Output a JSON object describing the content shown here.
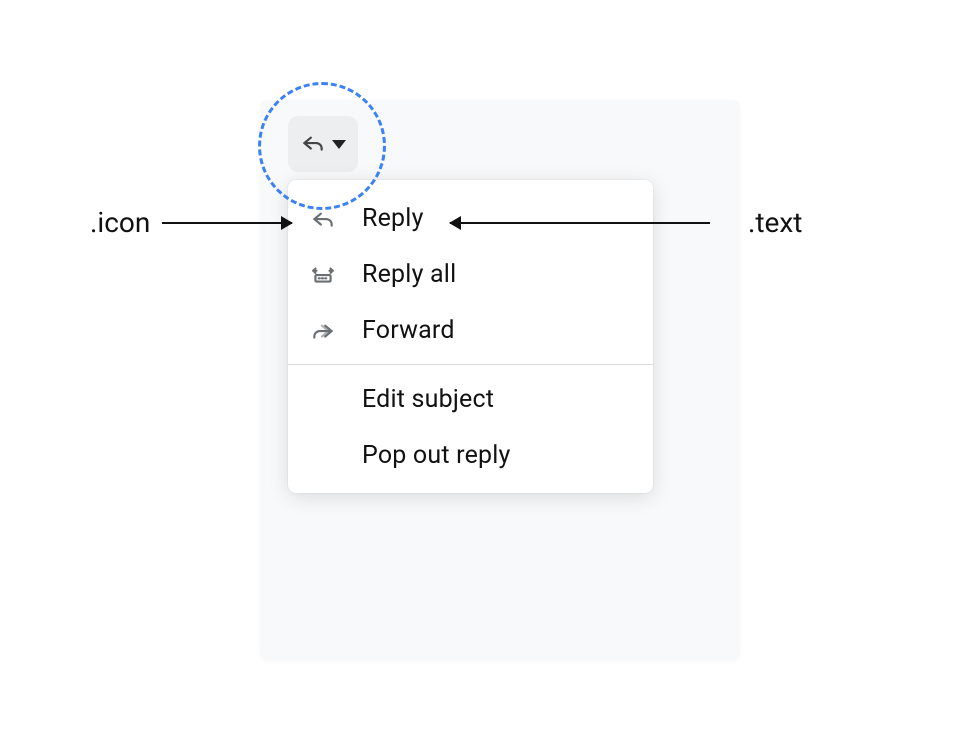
{
  "annotations": {
    "icon_label": ".icon",
    "text_label": ".text"
  },
  "trigger": {
    "icon": "reply"
  },
  "menu": {
    "items": [
      {
        "icon": "reply",
        "label": "Reply"
      },
      {
        "icon": "reply-all",
        "label": "Reply all"
      },
      {
        "icon": "forward",
        "label": "Forward"
      }
    ],
    "secondary_items": [
      {
        "label": "Edit subject"
      },
      {
        "label": "Pop out reply"
      }
    ]
  }
}
